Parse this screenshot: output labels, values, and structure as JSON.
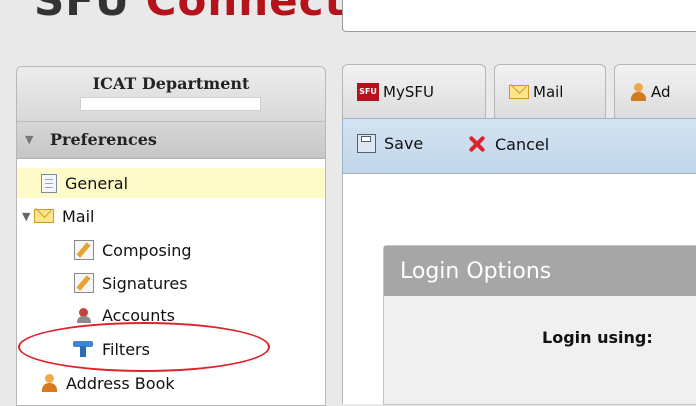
{
  "header": {
    "logo_sfu": "SFU",
    "logo_connect": "Connect",
    "search_value": ""
  },
  "left_panel": {
    "department": "ICAT Department",
    "preferences_title": "Preferences",
    "items": [
      {
        "label": "General",
        "icon": "document-icon",
        "selected": true
      },
      {
        "label": "Mail",
        "icon": "mail-icon",
        "expanded": true
      },
      {
        "label": "Composing",
        "icon": "compose-icon"
      },
      {
        "label": "Signatures",
        "icon": "signature-icon"
      },
      {
        "label": "Accounts",
        "icon": "accounts-icon"
      },
      {
        "label": "Filters",
        "icon": "filter-icon"
      },
      {
        "label": "Address Book",
        "icon": "address-book-icon"
      }
    ]
  },
  "tabs": [
    {
      "label": "MySFU",
      "icon": "sfu-icon"
    },
    {
      "label": "Mail",
      "icon": "mail-icon"
    },
    {
      "label": "Ad",
      "icon": "address-book-icon"
    }
  ],
  "toolbar": {
    "save_label": "Save",
    "cancel_label": "Cancel"
  },
  "login_options": {
    "title": "Login Options",
    "login_using_label": "Login using:"
  },
  "colors": {
    "brand_red": "#b5121b",
    "toolbar_blue": "#c8dbee",
    "selected_yellow": "#fffbc8",
    "annotation_red": "#d9252a"
  }
}
